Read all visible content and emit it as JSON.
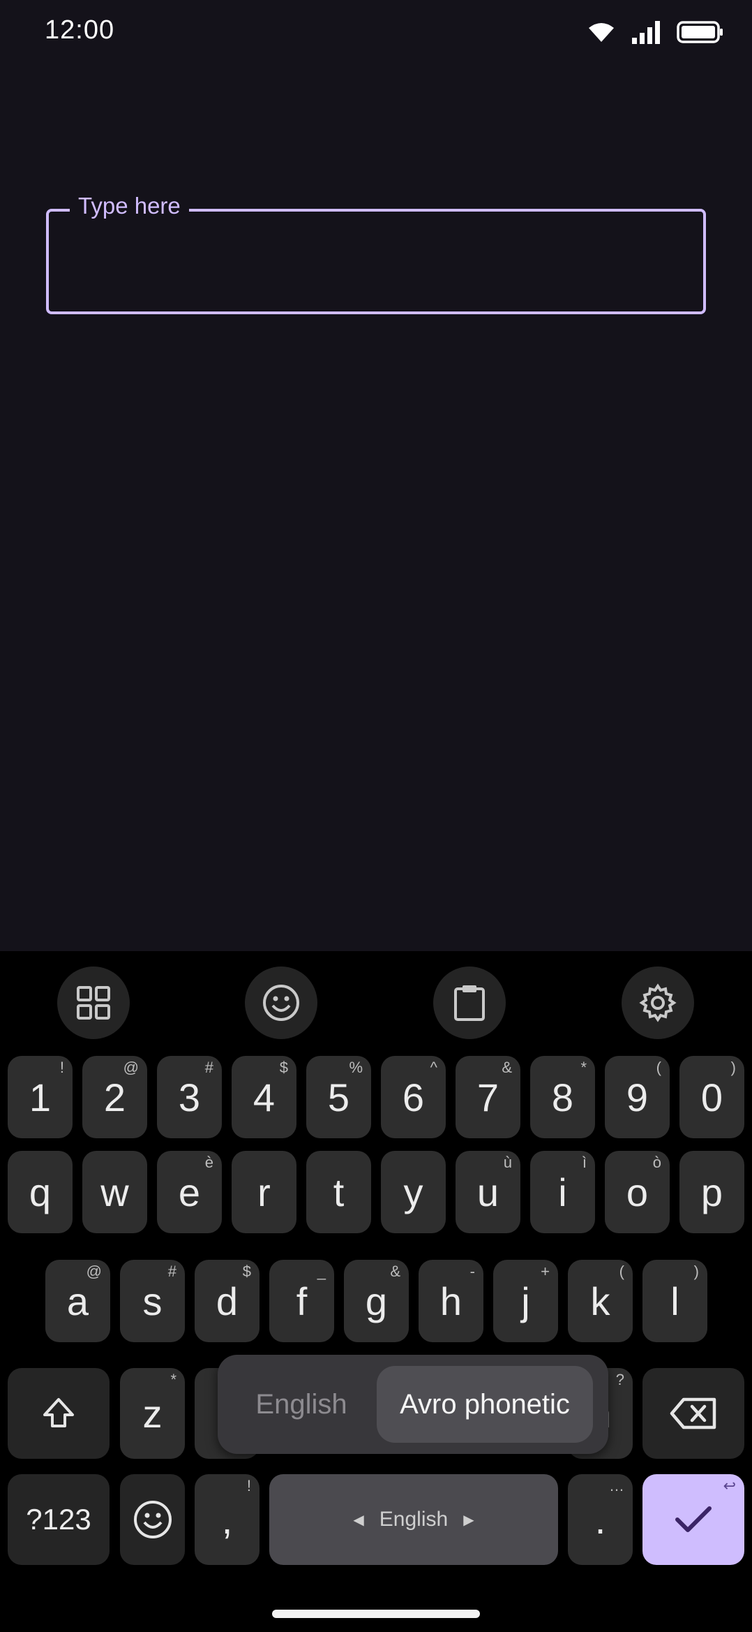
{
  "status": {
    "time": "12:00"
  },
  "text_field": {
    "label": "Type here",
    "value": ""
  },
  "toolbar": {
    "items": [
      {
        "icon": "grid-icon"
      },
      {
        "icon": "emoji-icon"
      },
      {
        "icon": "clipboard-icon"
      },
      {
        "icon": "gear-icon"
      }
    ]
  },
  "keyboard": {
    "row1": [
      {
        "label": "1",
        "hint": "!"
      },
      {
        "label": "2",
        "hint": "@"
      },
      {
        "label": "3",
        "hint": "#"
      },
      {
        "label": "4",
        "hint": "$"
      },
      {
        "label": "5",
        "hint": "%"
      },
      {
        "label": "6",
        "hint": "^"
      },
      {
        "label": "7",
        "hint": "&"
      },
      {
        "label": "8",
        "hint": "*"
      },
      {
        "label": "9",
        "hint": "("
      },
      {
        "label": "0",
        "hint": ")"
      }
    ],
    "row2": [
      {
        "label": "q",
        "hint": ""
      },
      {
        "label": "w",
        "hint": ""
      },
      {
        "label": "e",
        "hint": "è"
      },
      {
        "label": "r",
        "hint": ""
      },
      {
        "label": "t",
        "hint": ""
      },
      {
        "label": "y",
        "hint": ""
      },
      {
        "label": "u",
        "hint": "ù"
      },
      {
        "label": "i",
        "hint": "ì"
      },
      {
        "label": "o",
        "hint": "ò"
      },
      {
        "label": "p",
        "hint": ""
      }
    ],
    "row3": [
      {
        "label": "a",
        "hint": "@"
      },
      {
        "label": "s",
        "hint": "#"
      },
      {
        "label": "d",
        "hint": "$"
      },
      {
        "label": "f",
        "hint": "_"
      },
      {
        "label": "g",
        "hint": "&"
      },
      {
        "label": "h",
        "hint": "-"
      },
      {
        "label": "j",
        "hint": "+"
      },
      {
        "label": "k",
        "hint": "("
      },
      {
        "label": "l",
        "hint": ")"
      }
    ],
    "row4": [
      {
        "label": "z",
        "hint": "*"
      },
      {
        "label": "n",
        "hint": "?"
      }
    ],
    "row5": {
      "symbols_label": "?123",
      "comma": {
        "label": ",",
        "hint": "!"
      },
      "space_label": "English",
      "period": {
        "label": ".",
        "hint": "…"
      },
      "enter_hint": "↩"
    }
  },
  "language_popup": {
    "options": [
      "English",
      "Avro phonetic"
    ],
    "selected": "Avro phonetic"
  }
}
